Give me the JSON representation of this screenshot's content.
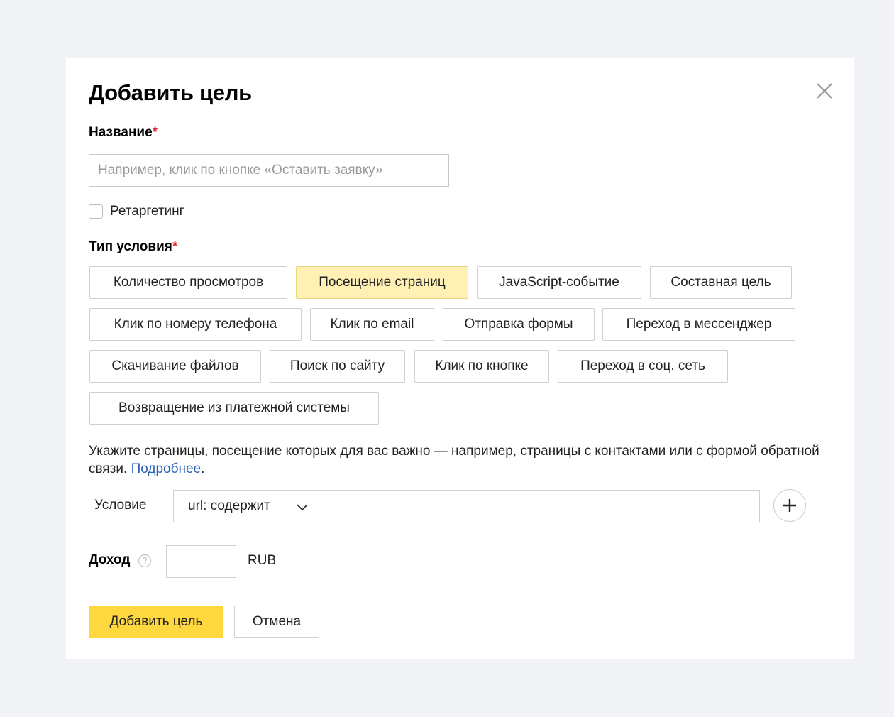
{
  "dialog": {
    "title": "Добавить цель",
    "close_icon": "close-icon",
    "name_label": "Название",
    "required_mark": "*",
    "name_placeholder": "Например, клик по кнопке «Оставить заявку»",
    "name_value": "",
    "retargeting_label": "Ретаргетинг",
    "retargeting_checked": false,
    "type_label": "Тип условия",
    "types": [
      {
        "label": "Количество просмотров",
        "selected": false
      },
      {
        "label": "Посещение страниц",
        "selected": true
      },
      {
        "label": "JavaScript-событие",
        "selected": false
      },
      {
        "label": "Составная цель",
        "selected": false
      },
      {
        "label": "Клик по номеру телефона",
        "selected": false
      },
      {
        "label": "Клик по email",
        "selected": false
      },
      {
        "label": "Отправка формы",
        "selected": false
      },
      {
        "label": "Переход в мессенджер",
        "selected": false
      },
      {
        "label": "Скачивание файлов",
        "selected": false
      },
      {
        "label": "Поиск по сайту",
        "selected": false
      },
      {
        "label": "Клик по кнопке",
        "selected": false
      },
      {
        "label": "Переход в соц. сеть",
        "selected": false
      },
      {
        "label": "Возвращение из платежной системы",
        "selected": false
      }
    ],
    "hint_text": "Укажите страницы, посещение которых для вас важно — например, страницы с контактами или с формой обратной связи. ",
    "hint_link": "Подробнее",
    "hint_tail": ".",
    "condition_label": "Условие",
    "condition_select": "url: содержит",
    "condition_value": "",
    "income_label": "Доход",
    "income_value": "",
    "currency": "RUB",
    "submit_label": "Добавить цель",
    "cancel_label": "Отмена"
  },
  "colors": {
    "page_bg": "#f1f3f6",
    "selected_type_bg": "#fff0b3",
    "primary_button": "#ffd83f",
    "link": "#2a62b5",
    "required": "#e0292b"
  }
}
